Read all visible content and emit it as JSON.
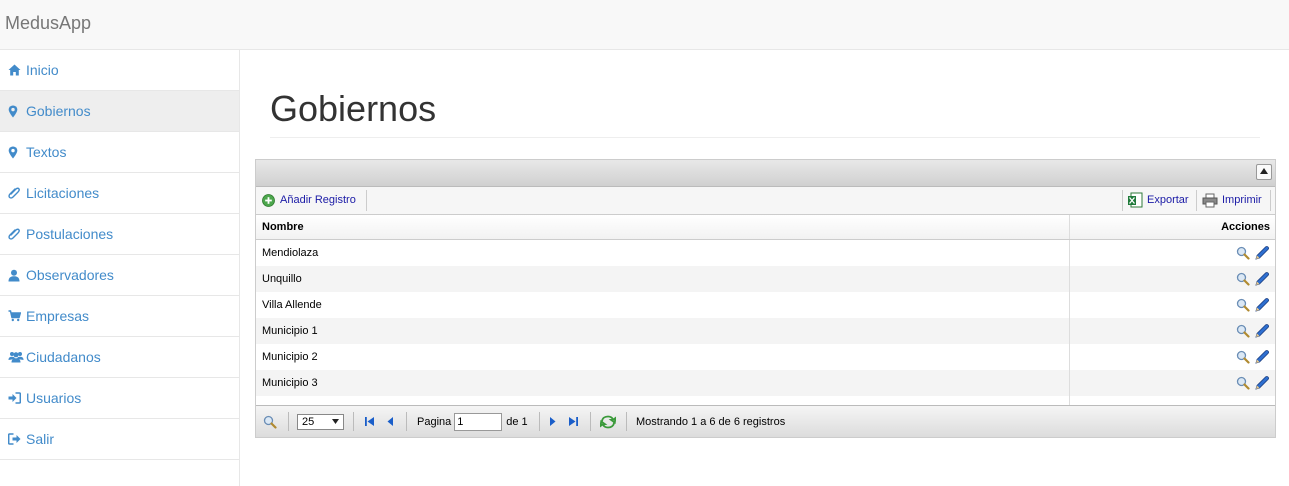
{
  "app": {
    "brand": "MedusApp"
  },
  "sidebar": {
    "items": [
      {
        "label": "Inicio",
        "icon": "home-icon"
      },
      {
        "label": "Gobiernos",
        "icon": "map-marker-icon",
        "active": true
      },
      {
        "label": "Textos",
        "icon": "map-marker-icon"
      },
      {
        "label": "Licitaciones",
        "icon": "paperclip-icon"
      },
      {
        "label": "Postulaciones",
        "icon": "paperclip-icon"
      },
      {
        "label": "Observadores",
        "icon": "user-icon"
      },
      {
        "label": "Empresas",
        "icon": "shopping-cart-icon"
      },
      {
        "label": "Ciudadanos",
        "icon": "users-icon"
      },
      {
        "label": "Usuarios",
        "icon": "sign-in-icon"
      },
      {
        "label": "Salir",
        "icon": "sign-out-icon"
      }
    ]
  },
  "page": {
    "title": "Gobiernos"
  },
  "toolbar": {
    "add_label": "Añadir Registro",
    "export_label": "Exportar",
    "print_label": "Imprimir"
  },
  "table": {
    "columns": [
      "Nombre",
      "Acciones"
    ],
    "rows": [
      "Mendiolaza",
      "Unquillo",
      "Villa Allende",
      "Municipio 1",
      "Municipio 2",
      "Municipio 3"
    ]
  },
  "pager": {
    "page_size": "25",
    "page_label": "Pagina",
    "page_value": "1",
    "of_label": "de 1",
    "status": "Mostrando 1 a 6 de 6 registros"
  },
  "colors": {
    "link": "#428bca",
    "active_bg": "#eeeeee",
    "toolbar_link": "#1a1aa6"
  }
}
